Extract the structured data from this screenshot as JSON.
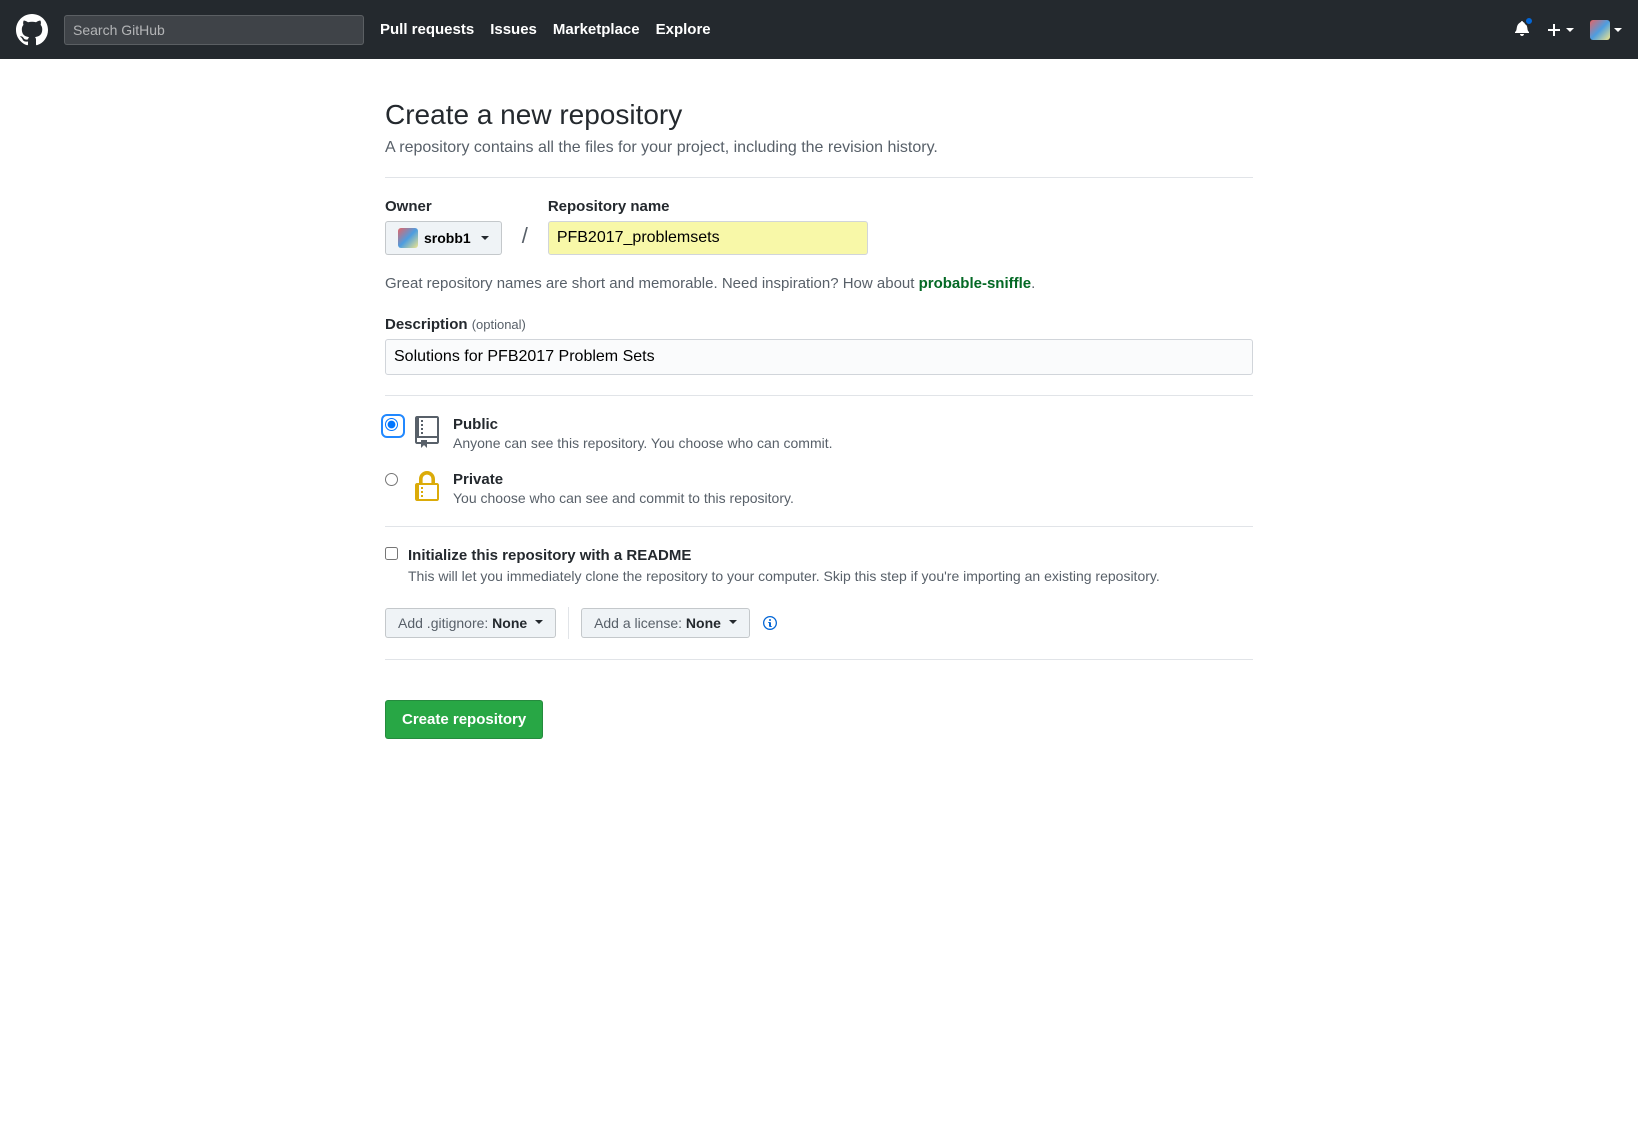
{
  "header": {
    "search_placeholder": "Search GitHub",
    "nav": {
      "pull_requests": "Pull requests",
      "issues": "Issues",
      "marketplace": "Marketplace",
      "explore": "Explore"
    }
  },
  "page": {
    "title": "Create a new repository",
    "subtitle": "A repository contains all the files for your project, including the revision history."
  },
  "form": {
    "owner_label": "Owner",
    "owner_value": "srobb1",
    "slash": "/",
    "repo_label": "Repository name",
    "repo_value": "PFB2017_problemsets",
    "hint_prefix": "Great repository names are short and memorable. Need inspiration? How about ",
    "hint_suggestion": "probable-sniffle",
    "hint_suffix": ".",
    "description_label": "Description",
    "description_optional": "(optional)",
    "description_value": "Solutions for PFB2017 Problem Sets",
    "visibility": {
      "public": {
        "title": "Public",
        "desc": "Anyone can see this repository. You choose who can commit."
      },
      "private": {
        "title": "Private",
        "desc": "You choose who can see and commit to this repository."
      }
    },
    "init": {
      "title": "Initialize this repository with a README",
      "desc": "This will let you immediately clone the repository to your computer. Skip this step if you're importing an existing repository."
    },
    "gitignore": {
      "prefix": "Add .gitignore: ",
      "value": "None"
    },
    "license": {
      "prefix": "Add a license: ",
      "value": "None"
    },
    "submit": "Create repository"
  }
}
